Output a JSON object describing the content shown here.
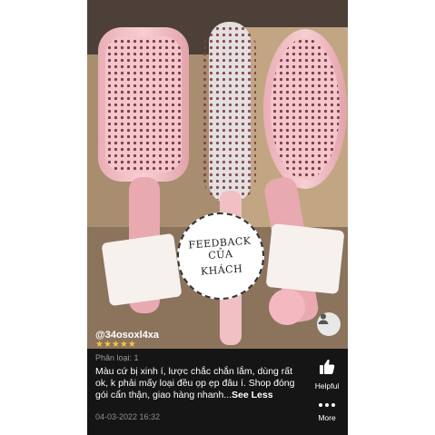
{
  "photo": {
    "badge_line1": "FEEDBACK CỦA",
    "badge_line2": "KHÁCH"
  },
  "review": {
    "username": "@34osoxl4xa",
    "stars": "★★★★★",
    "rating": 5,
    "variant": "Phân loại: 1",
    "text": "Màu cứ bị xinh í, lược chắc chắn lắm, dùng rất ok, k phải mấy loại đều ọp ẹp đâu í. Shop đóng gói cẩn thận, giao hàng nhanh...",
    "see_less": "See Less",
    "date": "04-03-2022 16:32"
  },
  "actions": {
    "helpful_label": "Helpful",
    "more_label": "More"
  },
  "colors": {
    "background": "#151515",
    "star": "#f6c445",
    "brush": "#f2c2c6"
  },
  "icons": {
    "helpful": "thumbs-up-icon",
    "more": "more-dots-icon",
    "profile": "user-icon"
  }
}
